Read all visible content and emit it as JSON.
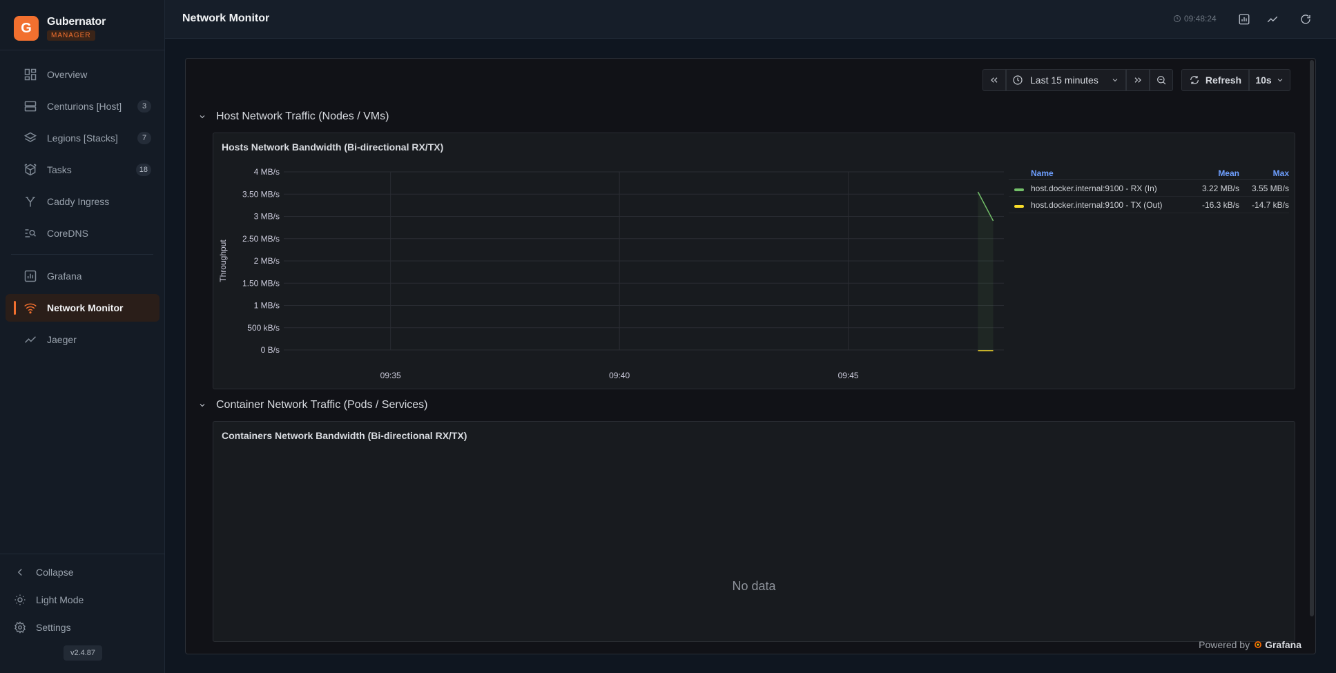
{
  "brand": {
    "logo_letter": "G",
    "name": "Gubernator",
    "badge": "MANAGER",
    "accent": "#f2702f"
  },
  "sidebar": {
    "items": [
      {
        "label": "Overview",
        "icon": "dashboard-icon",
        "badge": ""
      },
      {
        "label": "Centurions [Host]",
        "icon": "server-icon",
        "badge": "3"
      },
      {
        "label": "Legions [Stacks]",
        "icon": "layers-icon",
        "badge": "7"
      },
      {
        "label": "Tasks",
        "icon": "box-icon",
        "badge": "18"
      },
      {
        "label": "Caddy Ingress",
        "icon": "fork-icon",
        "badge": ""
      },
      {
        "label": "CoreDNS",
        "icon": "dns-search-icon",
        "badge": ""
      },
      {
        "label": "Grafana",
        "icon": "grafana-chart-icon",
        "badge": ""
      },
      {
        "label": "Network Monitor",
        "icon": "wifi-icon",
        "badge": "",
        "active": true
      },
      {
        "label": "Jaeger",
        "icon": "activity-icon",
        "badge": ""
      }
    ],
    "bottom": {
      "collapse": "Collapse",
      "light_mode": "Light Mode",
      "settings": "Settings",
      "version": "v2.4.87"
    }
  },
  "header": {
    "title": "Network Monitor",
    "clock": "09:48:24"
  },
  "grafana": {
    "time_range": "Last 15 minutes",
    "refresh": "Refresh",
    "refresh_interval": "10s",
    "rows": [
      {
        "title": "Host Network Traffic (Nodes / VMs)"
      },
      {
        "title": "Container Network Traffic (Pods / Services)"
      }
    ],
    "panels": [
      {
        "title": "Hosts Network Bandwidth (Bi-directional RX/TX)"
      },
      {
        "title": "Containers Network Bandwidth (Bi-directional RX/TX)",
        "empty_text": "No data"
      }
    ],
    "legend": {
      "headers": {
        "name": "Name",
        "mean": "Mean",
        "max": "Max"
      },
      "rows": [
        {
          "name": "host.docker.internal:9100 - RX (In)",
          "mean": "3.22 MB/s",
          "max": "3.55 MB/s",
          "color": "#73bf69"
        },
        {
          "name": "host.docker.internal:9100 - TX (Out)",
          "mean": "-16.3 kB/s",
          "max": "-14.7 kB/s",
          "color": "#fade2a"
        }
      ]
    },
    "powered_by": "Powered by",
    "powered_brand": "Grafana"
  },
  "chart_data": {
    "type": "line",
    "title": "Hosts Network Bandwidth (Bi-directional RX/TX)",
    "ylabel": "Throughput",
    "xlabel": "",
    "y_unit": "MB/s",
    "ylim": [
      0,
      4
    ],
    "y_ticks": [
      {
        "value": 0,
        "label": "0 B/s"
      },
      {
        "value": 0.5,
        "label": "500 kB/s"
      },
      {
        "value": 1,
        "label": "1 MB/s"
      },
      {
        "value": 1.5,
        "label": "1.50 MB/s"
      },
      {
        "value": 2,
        "label": "2 MB/s"
      },
      {
        "value": 2.5,
        "label": "2.50 MB/s"
      },
      {
        "value": 3,
        "label": "3 MB/s"
      },
      {
        "value": 3.5,
        "label": "3.50 MB/s"
      },
      {
        "value": 4,
        "label": "4 MB/s"
      }
    ],
    "x_range": [
      "09:32:40",
      "09:48:24"
    ],
    "x_ticks": [
      "09:35",
      "09:40",
      "09:45"
    ],
    "grid": true,
    "legend_position": "right",
    "series": [
      {
        "name": "host.docker.internal:9100 - RX (In)",
        "color": "#73bf69",
        "x": [
          "09:47:50",
          "09:48:10"
        ],
        "values": [
          3.55,
          2.9
        ]
      },
      {
        "name": "host.docker.internal:9100 - TX (Out)",
        "color": "#fade2a",
        "x": [
          "09:47:50",
          "09:48:10"
        ],
        "values": [
          -0.016,
          -0.015
        ]
      }
    ]
  }
}
